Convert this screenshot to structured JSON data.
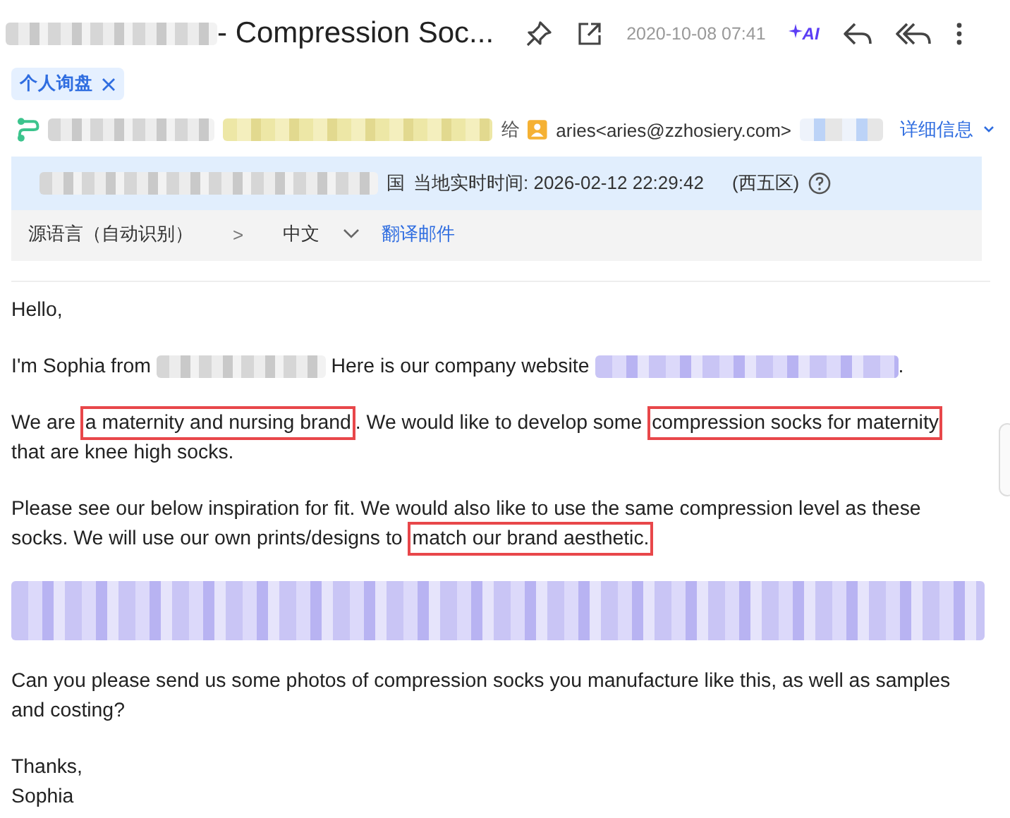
{
  "header": {
    "title": "- Compression Soc...",
    "date": "2020-10-08 07:41",
    "ai_label": "AI"
  },
  "tags": [
    {
      "label": "个人询盘",
      "removable": true
    }
  ],
  "sender": {
    "forward_label": "给",
    "recipient": "aries<aries@zzhosiery.com>",
    "details_link": "详细信息"
  },
  "local_time": {
    "country_fragment": "国",
    "label": "当地实时时间: 2026-02-12 22:29:42",
    "zone": "(西五区)"
  },
  "translate": {
    "source": "源语言（自动识别）",
    "arrow": ">",
    "target": "中文",
    "action": "翻译邮件"
  },
  "body": [
    {
      "segments": [
        {
          "kind": "text",
          "text": "Hello,"
        }
      ]
    },
    {
      "segments": [
        {
          "kind": "text",
          "text": "I'm Sophia from "
        },
        {
          "kind": "blur"
        },
        {
          "kind": "text",
          "text": " Here is our company website "
        },
        {
          "kind": "link_blur"
        },
        {
          "kind": "text",
          "text": "."
        }
      ]
    },
    {
      "segments": [
        {
          "kind": "text",
          "text": "We are "
        },
        {
          "kind": "highlight",
          "text": "a maternity and nursing brand"
        },
        {
          "kind": "text",
          "text": ". We would like to develop some "
        },
        {
          "kind": "highlight",
          "text": "compression socks for maternity"
        },
        {
          "kind": "break"
        },
        {
          "kind": "text",
          "text": "that are knee high socks."
        }
      ]
    },
    {
      "segments": [
        {
          "kind": "text",
          "text": "Please see our below inspiration for fit. We would also like to use the same compression level as these"
        },
        {
          "kind": "break"
        },
        {
          "kind": "text",
          "text": "socks. We will use our own prints/designs to "
        },
        {
          "kind": "highlight",
          "text": "match our brand aesthetic."
        }
      ]
    },
    {
      "segments": [
        {
          "kind": "blur_block"
        }
      ]
    },
    {
      "segments": [
        {
          "kind": "text",
          "text": "Can you please send us some photos of compression socks you manufacture like this, as well as samples and costing?"
        }
      ]
    },
    {
      "segments": [
        {
          "kind": "text",
          "text": "Thanks,"
        },
        {
          "kind": "break"
        },
        {
          "kind": "text",
          "text": "Sophia"
        }
      ]
    }
  ]
}
